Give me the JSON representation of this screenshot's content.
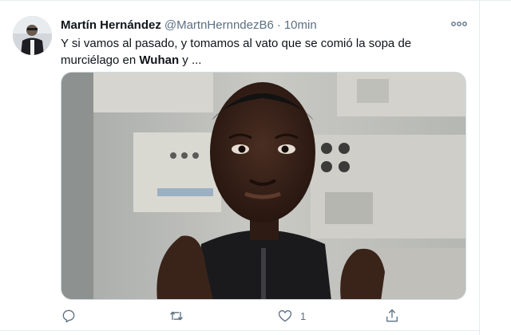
{
  "tweet": {
    "author_name": "Martín Hernández",
    "handle": "@MartnHernndezB6",
    "separator": "·",
    "time": "10min",
    "text_part1": "Y si vamos al pasado, y tomamos al vato que se comió la sopa de murciélago en ",
    "text_bold": "Wuhan",
    "text_part2": " y ...",
    "media_icon": "meme-photo",
    "avatar_icon": "user-avatar"
  },
  "actions": {
    "reply_icon": "reply-icon",
    "retweet_icon": "retweet-icon",
    "like_icon": "like-icon",
    "like_count": "1",
    "share_icon": "share-icon"
  },
  "colors": {
    "text": "#0f1419",
    "secondary": "#5b7083",
    "border": "#e6ecf0"
  }
}
